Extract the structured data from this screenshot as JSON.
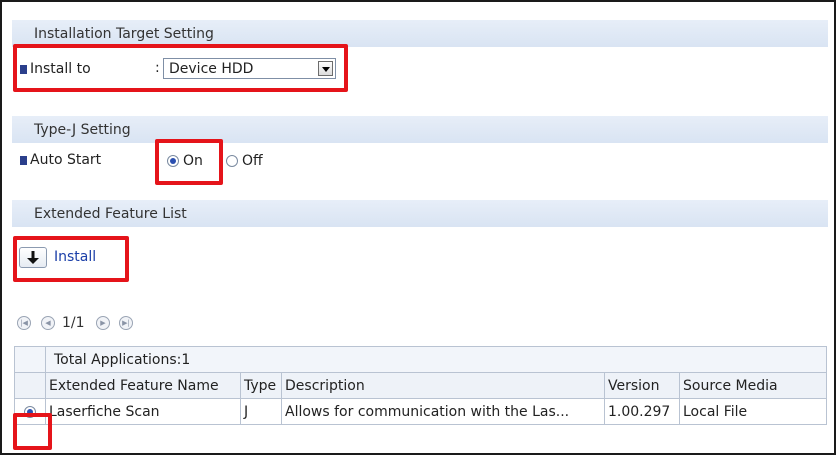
{
  "sections": {
    "installation_target": "Installation Target Setting",
    "type_j": "Type-J Setting",
    "extended_list": "Extended Feature List"
  },
  "install_to": {
    "label": "Install to",
    "separator": ":",
    "selected": "Device HDD"
  },
  "auto_start": {
    "label": "Auto Start",
    "options": [
      "On",
      "Off"
    ],
    "selected": "On"
  },
  "install_button": {
    "label": "Install"
  },
  "pager": {
    "text": "1/1"
  },
  "table": {
    "total_label": "Total Applications:1",
    "columns": [
      "Extended Feature Name",
      "Type",
      "Description",
      "Version",
      "Source Media"
    ],
    "rows": [
      {
        "selected": true,
        "name": "Laserfiche Scan",
        "type": "J",
        "description": "Allows for communication with the Las...",
        "version": "1.00.297",
        "source": "Local File"
      }
    ]
  },
  "colors": {
    "highlight": "#e5141a",
    "section_bg": "#dde7f4",
    "bullet": "#2b3f8c",
    "link": "#1a3ea8"
  }
}
